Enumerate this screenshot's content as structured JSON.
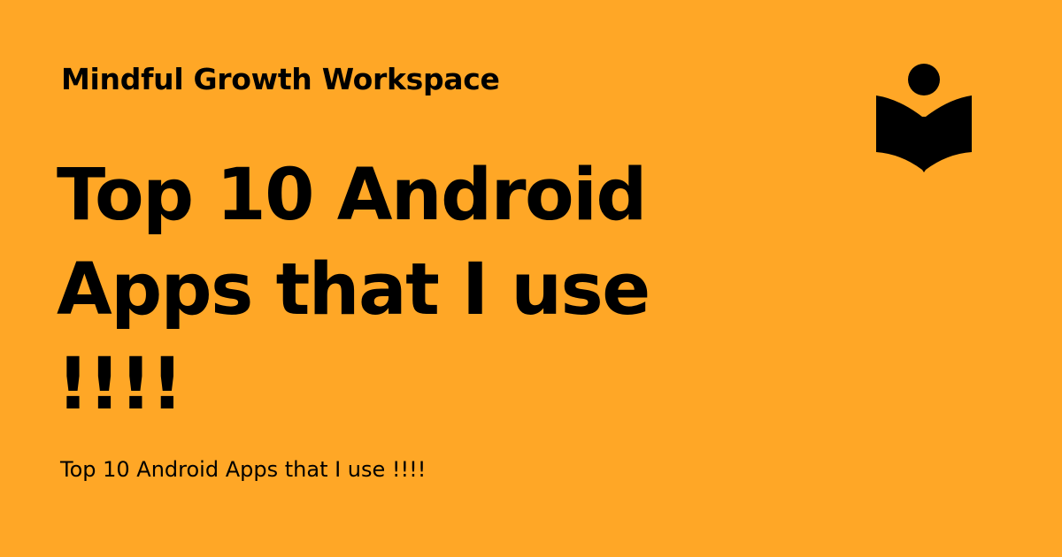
{
  "site": {
    "name": "Mindful Growth Workspace"
  },
  "post": {
    "title": "Top 10 Android Apps that I use !!!!",
    "subtitle": "Top 10 Android Apps that I use !!!!"
  },
  "colors": {
    "background": "#FFA726",
    "text": "#000000"
  },
  "icons": {
    "logo": "reader-book-icon"
  }
}
